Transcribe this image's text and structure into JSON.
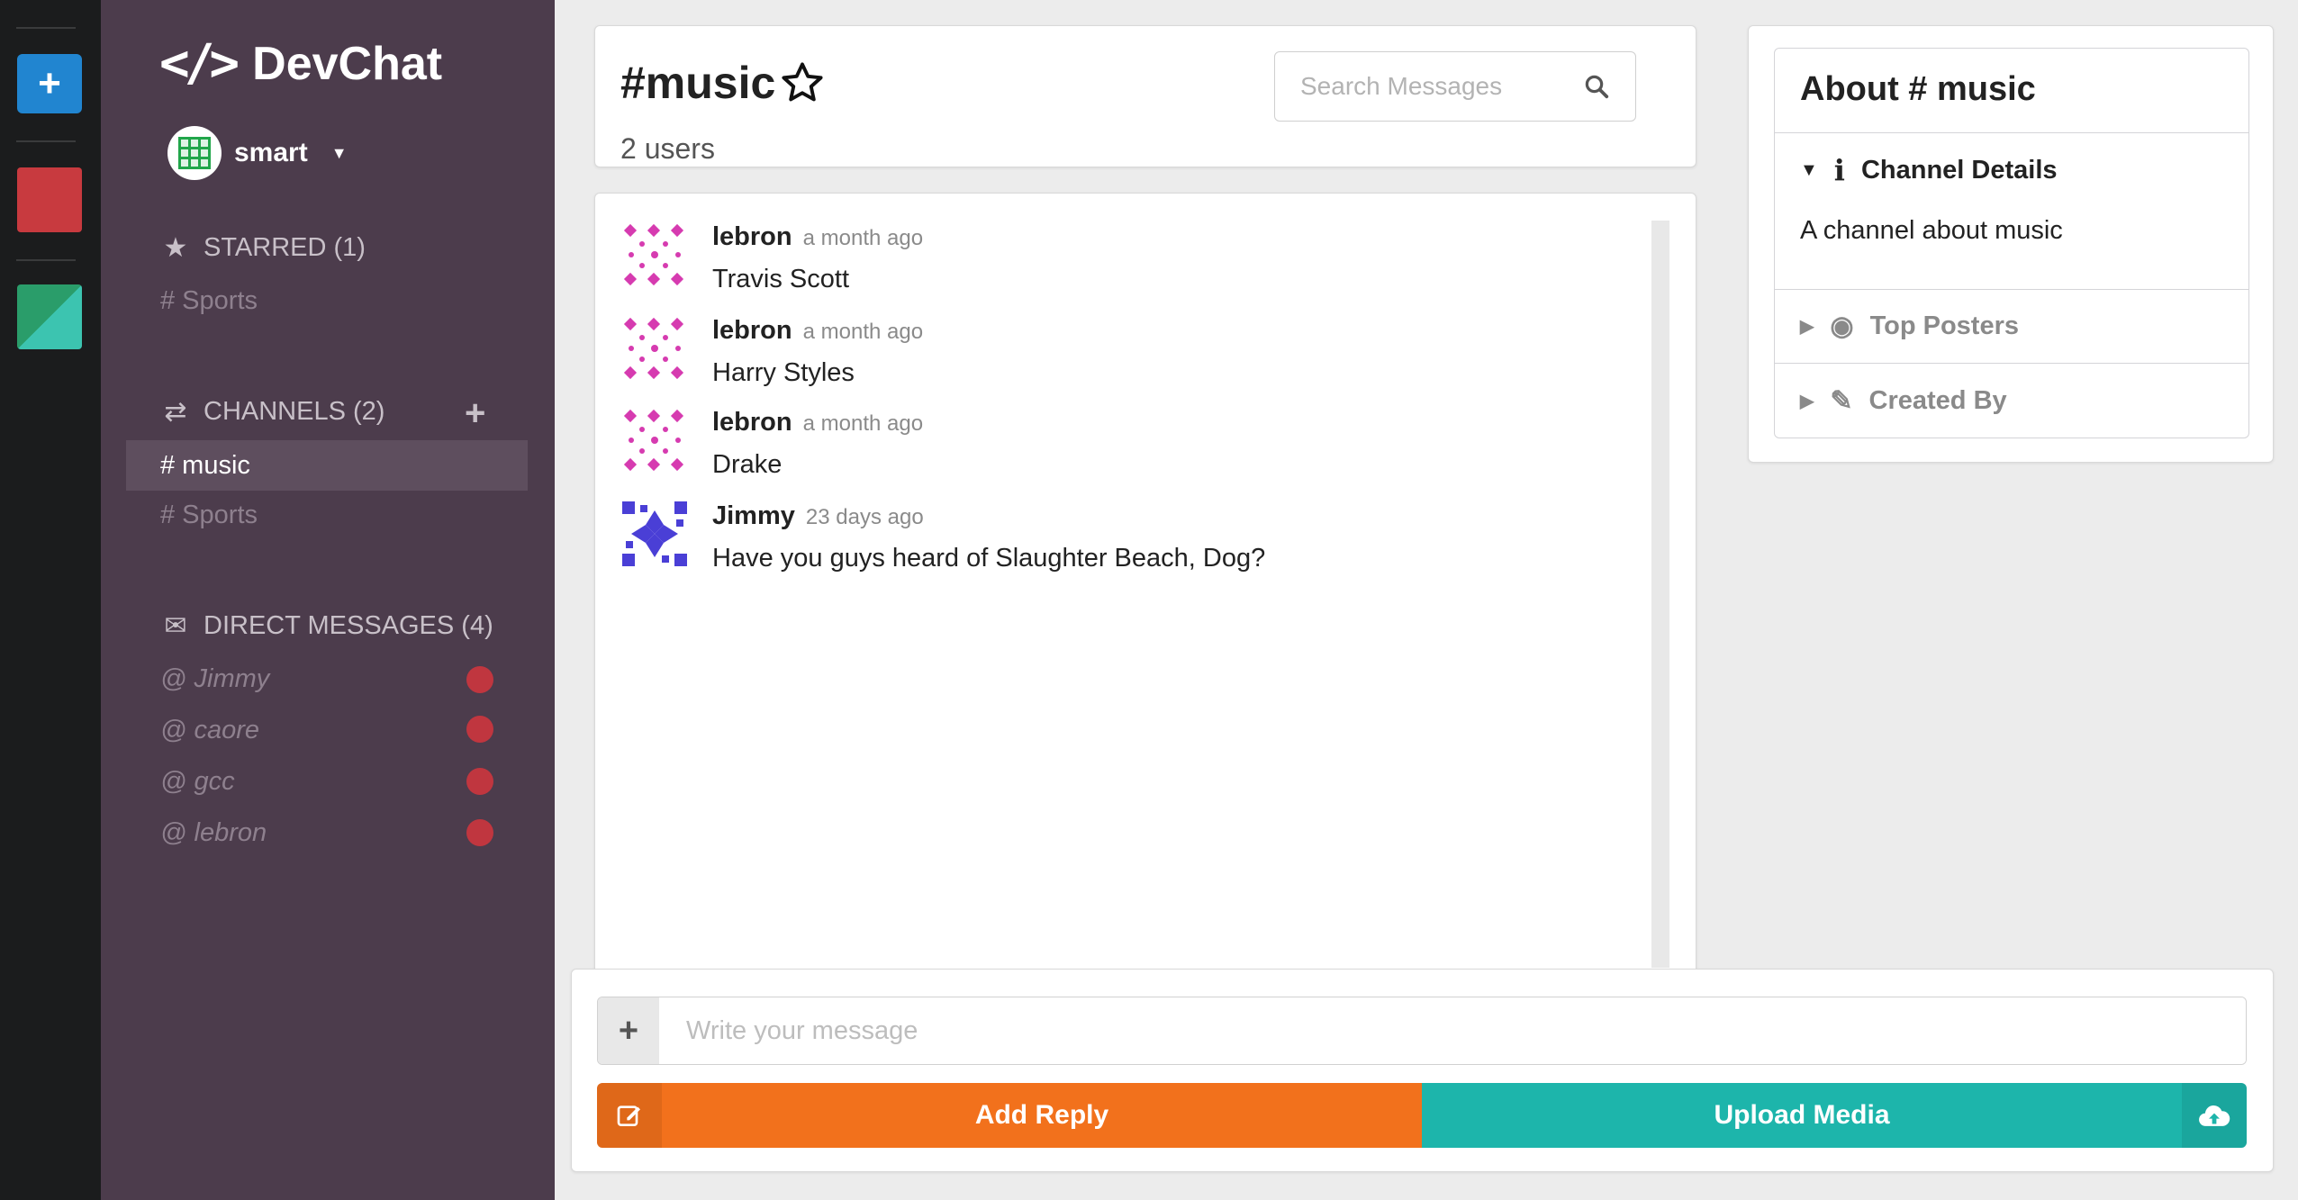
{
  "app": {
    "brand": "DevChat"
  },
  "user": {
    "name": "smart"
  },
  "colors": {
    "strip_red": "#c83a3f",
    "strip_green": "#2fb7a0",
    "reply": "#f2711c",
    "upload": "#1db5ab",
    "sidebar": "#4c3c4c"
  },
  "starred": {
    "header": "STARRED (1)",
    "items": [
      {
        "label": "# Sports"
      }
    ]
  },
  "channels": {
    "header": "CHANNELS (2)",
    "items": [
      {
        "label": "# music",
        "active": true
      },
      {
        "label": "# Sports",
        "active": false
      }
    ]
  },
  "direct_messages": {
    "header": "DIRECT MESSAGES (4)",
    "items": [
      {
        "label": "@ Jimmy"
      },
      {
        "label": "@ caore"
      },
      {
        "label": "@ gcc"
      },
      {
        "label": "@ lebron"
      }
    ]
  },
  "channel_header": {
    "title": "#music",
    "users": "2 users",
    "search_placeholder": "Search Messages"
  },
  "messages": [
    {
      "user": "lebron",
      "time": "a month ago",
      "text": "Travis Scott"
    },
    {
      "user": "lebron",
      "time": "a month ago",
      "text": "Harry Styles"
    },
    {
      "user": "lebron",
      "time": "a month ago",
      "text": "Drake"
    },
    {
      "user": "Jimmy",
      "time": "23 days ago",
      "text": "Have you guys heard of Slaughter Beach, Dog?"
    }
  ],
  "about": {
    "title": "About # music",
    "details_label": "Channel Details",
    "description": "A channel about music",
    "top_posters_label": "Top Posters",
    "created_by_label": "Created By"
  },
  "compose": {
    "placeholder": "Write your message",
    "reply_label": "Add Reply",
    "upload_label": "Upload Media"
  }
}
